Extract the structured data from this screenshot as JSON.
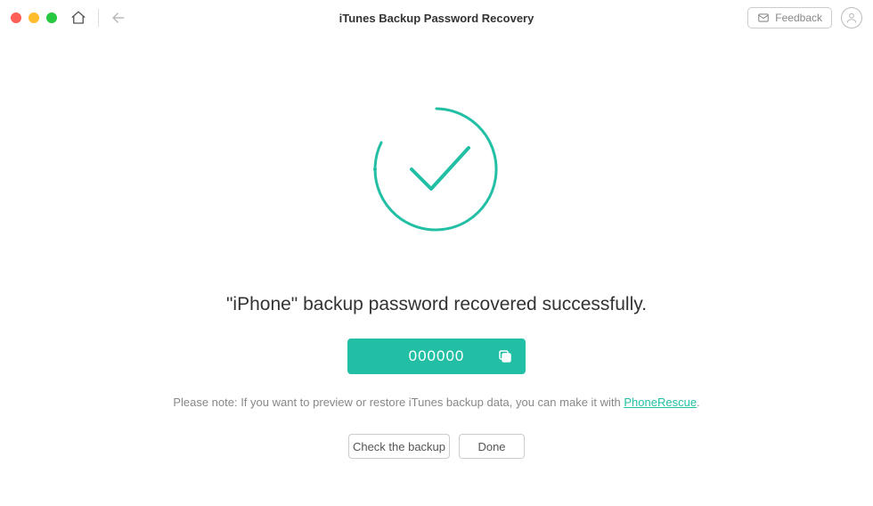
{
  "titlebar": {
    "title": "iTunes Backup Password Recovery",
    "feedback_label": "Feedback"
  },
  "content": {
    "success_message": "\"iPhone\" backup password recovered successfully.",
    "recovered_password": "000000",
    "note_prefix": "Please note: If you want to preview or restore iTunes backup data, you can make it with ",
    "note_link": "PhoneRescue",
    "note_suffix": ".",
    "check_button": "Check the backup",
    "done_button": "Done"
  },
  "colors": {
    "accent": "#22bfa5"
  }
}
